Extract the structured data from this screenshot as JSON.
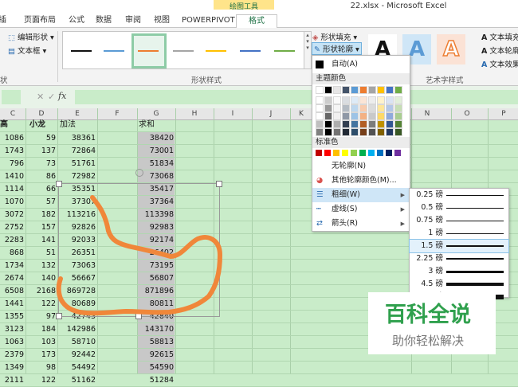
{
  "window": {
    "title": "22.xlsx - Microsoft Excel",
    "context_label": "绘图工具"
  },
  "tabs": [
    "插入",
    "页面布局",
    "公式",
    "数据",
    "审阅",
    "视图",
    "POWERPIVOT",
    "格式"
  ],
  "active_tab": "格式",
  "ribbon": {
    "left_items": [
      "编辑形状",
      "文本框"
    ],
    "left_group_fragment": "状",
    "shape_styles_group": "形状样式",
    "style_colors": [
      "#111111",
      "#5b9bd5",
      "#ed7d31",
      "#a5a5a5",
      "#ffc000",
      "#4472c4",
      "#70ad47"
    ],
    "fill_button": "形状填充",
    "outline_button": "形状轮廓",
    "art_group": "艺术字样式",
    "art_right": [
      "文本填充",
      "文本轮廓",
      "文本效果"
    ],
    "art_letter": "A"
  },
  "formula_bar": {
    "fx": "fx",
    "cancel": "✕",
    "enter": "✓"
  },
  "columns": [
    "C",
    "D",
    "E",
    "F",
    "G",
    "H",
    "I",
    "J",
    "K",
    "N",
    "O",
    "P"
  ],
  "sheet": {
    "headers": {
      "c": "高",
      "d": "小龙",
      "e": "加法",
      "g": "求和"
    },
    "rows": [
      [
        "1086",
        "59",
        "38361",
        "38420"
      ],
      [
        "1743",
        "137",
        "72864",
        "73001"
      ],
      [
        "796",
        "73",
        "51761",
        "51834"
      ],
      [
        "1410",
        "86",
        "72982",
        "73068"
      ],
      [
        "1114",
        "66",
        "35351",
        "35417"
      ],
      [
        "1070",
        "57",
        "37307",
        "37364"
      ],
      [
        "3072",
        "182",
        "113216",
        "113398"
      ],
      [
        "2752",
        "157",
        "92826",
        "92983"
      ],
      [
        "2283",
        "141",
        "92033",
        "92174"
      ],
      [
        "868",
        "51",
        "26351",
        "26402"
      ],
      [
        "1734",
        "132",
        "73063",
        "73195"
      ],
      [
        "2674",
        "140",
        "56667",
        "56807"
      ],
      [
        "6508",
        "2168",
        "869728",
        "871896"
      ],
      [
        "1441",
        "122",
        "80689",
        "80811"
      ],
      [
        "1355",
        "97",
        "42743",
        "42840"
      ],
      [
        "3123",
        "184",
        "142986",
        "143170"
      ],
      [
        "1063",
        "103",
        "58710",
        "58813"
      ],
      [
        "2379",
        "173",
        "92442",
        "92615"
      ],
      [
        "1349",
        "98",
        "54492",
        "54590"
      ],
      [
        "2111",
        "122",
        "51162",
        "51284"
      ]
    ]
  },
  "dropdown": {
    "auto": "自动(A)",
    "theme_colors": "主题颜色",
    "standard_colors": "标准色",
    "no_outline": "无轮廓(N)",
    "more_colors": "其他轮廓颜色(M)...",
    "weight": "粗细(W)",
    "dashes": "虚线(S)",
    "arrows": "箭头(R)",
    "theme_top": [
      "#ffffff",
      "#000000",
      "#e7e6e6",
      "#44546a",
      "#5b9bd5",
      "#ed7d31",
      "#a5a5a5",
      "#ffc000",
      "#4472c4",
      "#70ad47"
    ],
    "standard": [
      "#c00000",
      "#ff0000",
      "#ffc000",
      "#ffff00",
      "#92d050",
      "#00b050",
      "#00b0f0",
      "#0070c0",
      "#002060",
      "#7030a0"
    ]
  },
  "weights": [
    "0.25 磅",
    "0.5 磅",
    "0.75 磅",
    "1 磅",
    "1.5 磅",
    "2.25 磅",
    "3 磅",
    "4.5 磅",
    "6 磅"
  ],
  "weight_selected": "1.5 磅",
  "watermark": {
    "title": "百科全说",
    "subtitle": "助你轻松解决"
  }
}
